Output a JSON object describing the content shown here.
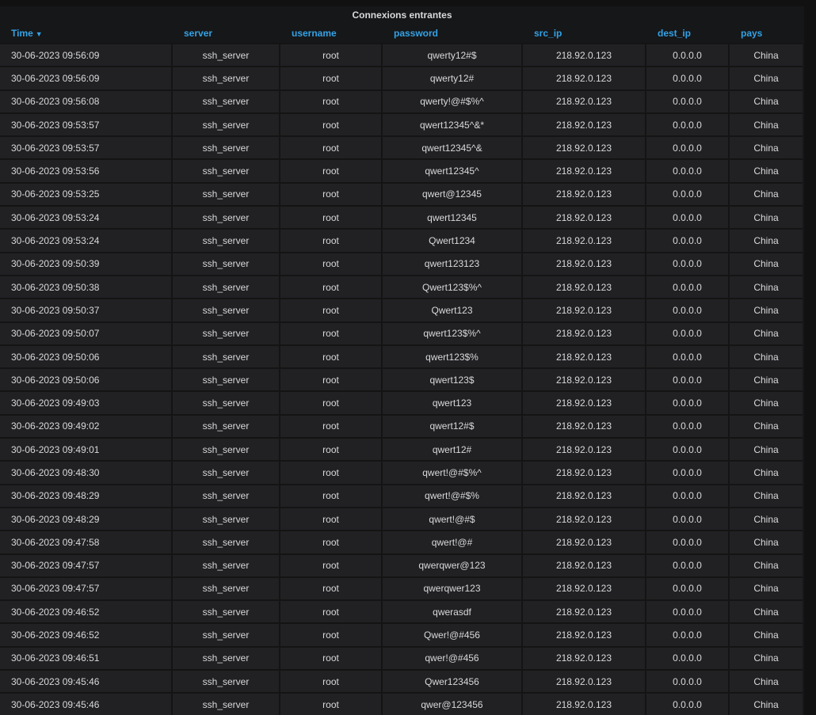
{
  "panel": {
    "title": "Connexions entrantes"
  },
  "table": {
    "columns": [
      {
        "key": "time",
        "label": "Time",
        "sorted": true
      },
      {
        "key": "server",
        "label": "server"
      },
      {
        "key": "username",
        "label": "username"
      },
      {
        "key": "password",
        "label": "password"
      },
      {
        "key": "src_ip",
        "label": "src_ip"
      },
      {
        "key": "dest_ip",
        "label": "dest_ip"
      },
      {
        "key": "pays",
        "label": "pays"
      }
    ],
    "sort_icon": "caret-down-icon",
    "rows": [
      [
        "30-06-2023 09:56:09",
        "ssh_server",
        "root",
        "qwerty12#$",
        "218.92.0.123",
        "0.0.0.0",
        "China"
      ],
      [
        "30-06-2023 09:56:09",
        "ssh_server",
        "root",
        "qwerty12#",
        "218.92.0.123",
        "0.0.0.0",
        "China"
      ],
      [
        "30-06-2023 09:56:08",
        "ssh_server",
        "root",
        "qwerty!@#$%^",
        "218.92.0.123",
        "0.0.0.0",
        "China"
      ],
      [
        "30-06-2023 09:53:57",
        "ssh_server",
        "root",
        "qwert12345^&*",
        "218.92.0.123",
        "0.0.0.0",
        "China"
      ],
      [
        "30-06-2023 09:53:57",
        "ssh_server",
        "root",
        "qwert12345^&",
        "218.92.0.123",
        "0.0.0.0",
        "China"
      ],
      [
        "30-06-2023 09:53:56",
        "ssh_server",
        "root",
        "qwert12345^",
        "218.92.0.123",
        "0.0.0.0",
        "China"
      ],
      [
        "30-06-2023 09:53:25",
        "ssh_server",
        "root",
        "qwert@12345",
        "218.92.0.123",
        "0.0.0.0",
        "China"
      ],
      [
        "30-06-2023 09:53:24",
        "ssh_server",
        "root",
        "qwert12345",
        "218.92.0.123",
        "0.0.0.0",
        "China"
      ],
      [
        "30-06-2023 09:53:24",
        "ssh_server",
        "root",
        "Qwert1234",
        "218.92.0.123",
        "0.0.0.0",
        "China"
      ],
      [
        "30-06-2023 09:50:39",
        "ssh_server",
        "root",
        "qwert123123",
        "218.92.0.123",
        "0.0.0.0",
        "China"
      ],
      [
        "30-06-2023 09:50:38",
        "ssh_server",
        "root",
        "Qwert123$%^",
        "218.92.0.123",
        "0.0.0.0",
        "China"
      ],
      [
        "30-06-2023 09:50:37",
        "ssh_server",
        "root",
        "Qwert123",
        "218.92.0.123",
        "0.0.0.0",
        "China"
      ],
      [
        "30-06-2023 09:50:07",
        "ssh_server",
        "root",
        "qwert123$%^",
        "218.92.0.123",
        "0.0.0.0",
        "China"
      ],
      [
        "30-06-2023 09:50:06",
        "ssh_server",
        "root",
        "qwert123$%",
        "218.92.0.123",
        "0.0.0.0",
        "China"
      ],
      [
        "30-06-2023 09:50:06",
        "ssh_server",
        "root",
        "qwert123$",
        "218.92.0.123",
        "0.0.0.0",
        "China"
      ],
      [
        "30-06-2023 09:49:03",
        "ssh_server",
        "root",
        "qwert123",
        "218.92.0.123",
        "0.0.0.0",
        "China"
      ],
      [
        "30-06-2023 09:49:02",
        "ssh_server",
        "root",
        "qwert12#$",
        "218.92.0.123",
        "0.0.0.0",
        "China"
      ],
      [
        "30-06-2023 09:49:01",
        "ssh_server",
        "root",
        "qwert12#",
        "218.92.0.123",
        "0.0.0.0",
        "China"
      ],
      [
        "30-06-2023 09:48:30",
        "ssh_server",
        "root",
        "qwert!@#$%^",
        "218.92.0.123",
        "0.0.0.0",
        "China"
      ],
      [
        "30-06-2023 09:48:29",
        "ssh_server",
        "root",
        "qwert!@#$%",
        "218.92.0.123",
        "0.0.0.0",
        "China"
      ],
      [
        "30-06-2023 09:48:29",
        "ssh_server",
        "root",
        "qwert!@#$",
        "218.92.0.123",
        "0.0.0.0",
        "China"
      ],
      [
        "30-06-2023 09:47:58",
        "ssh_server",
        "root",
        "qwert!@#",
        "218.92.0.123",
        "0.0.0.0",
        "China"
      ],
      [
        "30-06-2023 09:47:57",
        "ssh_server",
        "root",
        "qwerqwer@123",
        "218.92.0.123",
        "0.0.0.0",
        "China"
      ],
      [
        "30-06-2023 09:47:57",
        "ssh_server",
        "root",
        "qwerqwer123",
        "218.92.0.123",
        "0.0.0.0",
        "China"
      ],
      [
        "30-06-2023 09:46:52",
        "ssh_server",
        "root",
        "qwerasdf",
        "218.92.0.123",
        "0.0.0.0",
        "China"
      ],
      [
        "30-06-2023 09:46:52",
        "ssh_server",
        "root",
        "Qwer!@#456",
        "218.92.0.123",
        "0.0.0.0",
        "China"
      ],
      [
        "30-06-2023 09:46:51",
        "ssh_server",
        "root",
        "qwer!@#456",
        "218.92.0.123",
        "0.0.0.0",
        "China"
      ],
      [
        "30-06-2023 09:45:46",
        "ssh_server",
        "root",
        "Qwer123456",
        "218.92.0.123",
        "0.0.0.0",
        "China"
      ],
      [
        "30-06-2023 09:45:46",
        "ssh_server",
        "root",
        "qwer@123456",
        "218.92.0.123",
        "0.0.0.0",
        "China"
      ]
    ]
  },
  "colors": {
    "header_text": "#33a2e5",
    "cell_text": "#d8d9da",
    "cell_bg": "#212124",
    "panel_bg": "#161719"
  }
}
